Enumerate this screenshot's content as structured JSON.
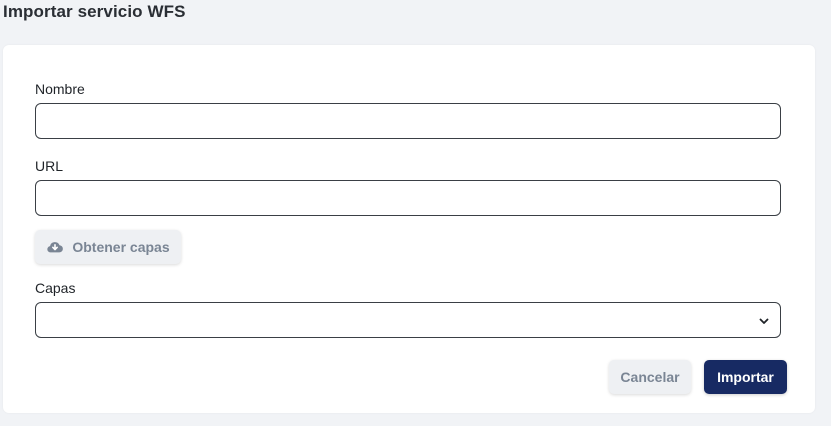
{
  "page": {
    "title": "Importar servicio WFS"
  },
  "form": {
    "name": {
      "label": "Nombre",
      "value": ""
    },
    "url": {
      "label": "URL",
      "value": ""
    },
    "fetch_layers_button": {
      "label": "Obtener capas",
      "icon": "cloud-download-icon"
    },
    "layers": {
      "label": "Capas",
      "selected": "",
      "icon": "chevron-down-icon"
    }
  },
  "actions": {
    "cancel_label": "Cancelar",
    "import_label": "Importar"
  },
  "colors": {
    "primary": "#172a63",
    "secondary_bg": "#eef0f3",
    "secondary_text": "#7a8594",
    "page_bg": "#f1f3f6"
  }
}
